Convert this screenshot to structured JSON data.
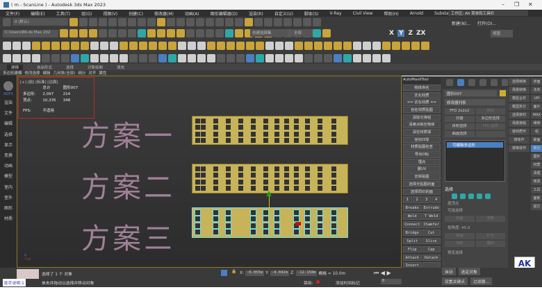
{
  "titlebar": {
    "title": "( m - ScanLine ) - Autodesk 3ds Max 2023",
    "minimize": "–",
    "maximize": "❐",
    "close": "✕"
  },
  "menu": [
    "文件(F)",
    "编辑(E)",
    "工具(T)",
    "组(G)",
    "视图(V)",
    "创建(C)",
    "修改器(M)",
    "动画(A)",
    "图形编辑器(D)",
    "渲染(R)",
    "自定义(U)",
    "脚本(S)",
    "V-Ray",
    "Civil View",
    "帮助(H)",
    "Arnold",
    "Substance",
    "D5"
  ],
  "workspace": "工作区: Alt 菜单和工具栏",
  "toolbar": {
    "layer": "0 (默认)",
    "path": "C:\\Users\\86-ds Max 202",
    "selection_set": "创建选择集",
    "filter": "全部",
    "view": "视图",
    "new": "新建(N)...",
    "open": "打开(O)...",
    "axes": [
      "X",
      "Y",
      "Z",
      "ZX"
    ]
  },
  "ribbon": {
    "tabs": [
      "建模",
      "自由形式",
      "选择",
      "对象绘制",
      "填充"
    ],
    "active": 0,
    "sub": [
      "多边形建模",
      "修改选择",
      "编辑",
      "几何体(全部)",
      "细分",
      "对齐",
      "属性"
    ]
  },
  "leftstrip": {
    "brand": "RDF3",
    "items": [
      "渲染",
      "文件",
      "编辑",
      "选择",
      "显示",
      "变换",
      "动画",
      "模型",
      "室内",
      "室外",
      "图形",
      "材质"
    ]
  },
  "viewport": {
    "label": "[+] [前] [标准] [边面]",
    "stats": {
      "col_total": "总计",
      "col_object": "图形007",
      "polys_label": "多边形:",
      "polys_total": "2,097",
      "polys_object": "214",
      "verts_label": "顶点:",
      "verts_total": "10,335",
      "verts_object": "348",
      "fps_label": "FPS:",
      "fps_value": "不适用"
    },
    "texts": [
      "方案一",
      "方案二",
      "方案三"
    ]
  },
  "scripts": {
    "title": "AutoMaxIITool",
    "buttons": [
      "物体命名",
      "优化材质",
      "== 优化材质 ==",
      "自名材质贴图",
      "清除光滑组",
      "清离点和空物体",
      "清空材质球",
      "坐标归零",
      "材质贴图检查",
      "导出OBJ",
      "埋点",
      "展UV",
      "去除贴图",
      "选择无贴图的面",
      "选择同ID的面"
    ],
    "grid": [
      "Breake",
      "Extrude",
      "Weld",
      "T Weld",
      "Connect",
      "Chamfer",
      "Bridge",
      "Cut",
      "Split",
      "Slice",
      "Flip",
      "Cap",
      "Attach",
      "Detach",
      "Insert",
      ""
    ],
    "num": [
      "1",
      "2",
      "3",
      "4"
    ]
  },
  "cmdpanel": {
    "object_name": "图形007",
    "object_color": "#c9b030",
    "modifier_list": "修改器列表",
    "buttons": [
      "FFD 2x2x2",
      "挤出",
      "扫描",
      "多边形选择",
      "体积选择",
      "FFD 选择",
      "曲面选择",
      ""
    ],
    "stack_item": "可编辑多边形",
    "rollout": "选择",
    "by_vertex": "按顶点",
    "occluded": "可选选择",
    "ring": "背面",
    "loop": "忽略",
    "angle_label": "按角度:",
    "angle": "45.0",
    "shrink": "收缩",
    "grow": "扩大",
    "ring2": "环形",
    "loop2": "循环",
    "preview": "预览选择",
    "auto": "自动",
    "selected_obj": "选定对象",
    "set_key": "设置关键点",
    "filters": "过滤器..."
  },
  "extra": {
    "buttons": [
      "选择转换",
      "双面",
      "场景转换",
      "法向",
      "模型合并",
      "UPI",
      "模型拆分",
      "面片",
      "选择按材",
      "MAX",
      "场景按组",
      "维修",
      "按材质作",
      "组",
      "按体作",
      "破面",
      "按等体作",
      "简化",
      "",
      "图形",
      "",
      "材质",
      "",
      "清理",
      "",
      "修改",
      "",
      "工具",
      "",
      "面板",
      "",
      "其它"
    ],
    "highlight": 17,
    "logo": "AK",
    "logo_caption": "配置培训"
  },
  "status": {
    "selected": "选择了 1 个 对象",
    "hint": "单击并拖动以选择并移动对象",
    "x_label": "X:",
    "x": "-0.055m",
    "y_label": "Y:",
    "y": "-4.042m",
    "z_label": "Z:",
    "z": "-12.158m",
    "grid": "栅格 = 10.0m",
    "disabled": "禁用:",
    "add_time_tag": "添加时间标记",
    "frame": "0",
    "assistant": "助手说明:1"
  },
  "colors": {
    "accent": "#4a7fc0",
    "selection": "#6fe0e8",
    "building": "#c7b35a",
    "text_outline": "#a08098",
    "info_border": "#c0281f"
  }
}
